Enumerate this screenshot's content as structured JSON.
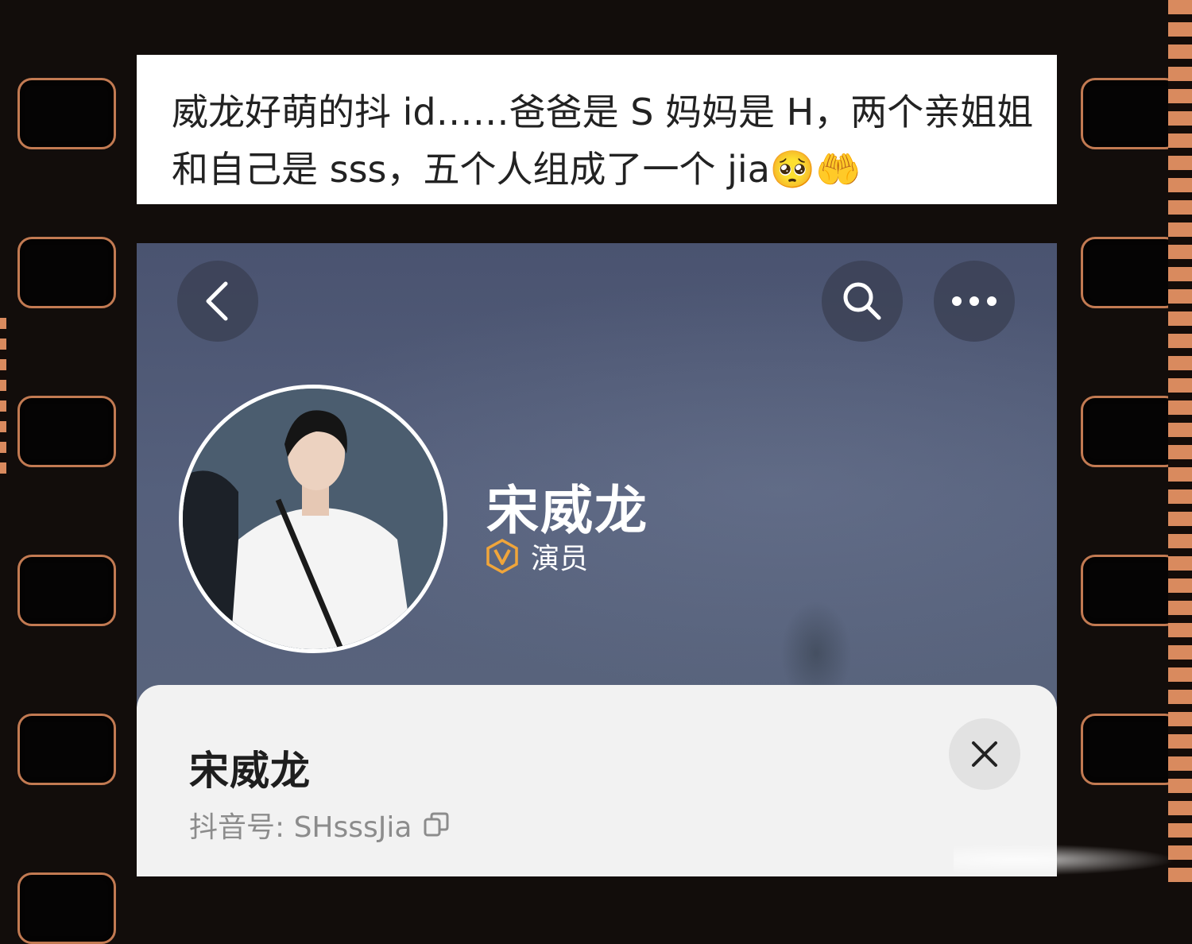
{
  "caption": {
    "line1": "威龙好萌的抖 id……爸爸是 S 妈妈是 H，两个亲姐姐",
    "line2": "和自己是 sss，五个人组成了一个 jia",
    "emoji1": "🥺",
    "emoji2": "🤲"
  },
  "profile": {
    "name": "宋威龙",
    "verified_label": "演员",
    "sheet": {
      "name": "宋威龙",
      "id_label": "抖音号: ",
      "id_value": "SHsssJia"
    }
  },
  "icons": {
    "back": "chevron-left-icon",
    "search": "search-icon",
    "more": "more-dots-icon",
    "verified": "verified-v-icon",
    "copy": "copy-icon",
    "close": "close-icon"
  },
  "colors": {
    "verified_badge": "#f0a53a",
    "header_bg": "#4f5973",
    "sheet_bg": "#f2f2f2",
    "film_border": "#c27a52"
  }
}
